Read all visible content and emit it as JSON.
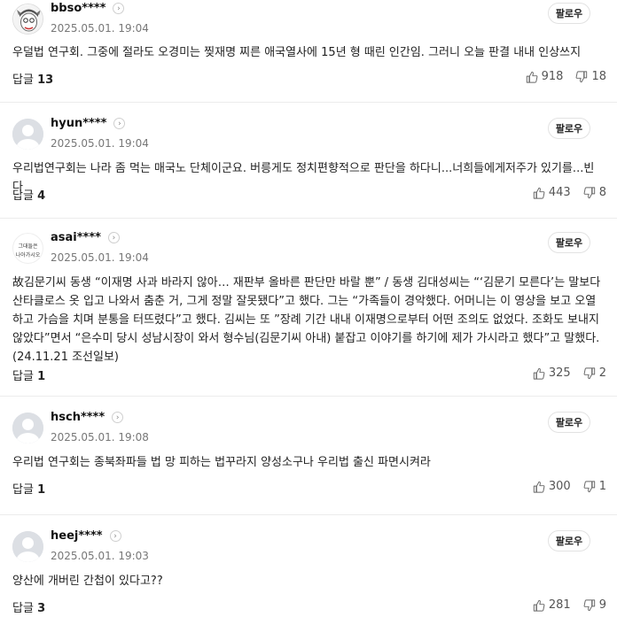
{
  "follow_label": "팔로우",
  "reply_label": "답글",
  "comments": [
    {
      "username": "bbso****",
      "date": "2025.05.01. 19:04",
      "text": "우덜법 연구회. 그중에 절라도 오경미는 찢재명 찌른 애국열사에 15년 형 때린 인간임. 그러니 오늘 판결 내내 인상쓰지",
      "replies": "13",
      "likes": "918",
      "dislikes": "18",
      "avatar": "cartoon-avatar"
    },
    {
      "username": "hyun****",
      "date": "2025.05.01. 19:04",
      "text": "우리법연구회는 나라 좀 먹는 매국노 단체이군요. 버릉게도 정치편향적으로 판단을 하다니...너희들에게저주가 있기를...빈다",
      "replies": "4",
      "likes": "443",
      "dislikes": "8",
      "avatar": "default-avatar"
    },
    {
      "username": "asai****",
      "date": "2025.05.01. 19:04",
      "text": "故김문기씨 동생 “이재명 사과 바라지 않아… 재판부 올바른 판단만 바랄 뿐” / 동생 김대성씨는 “‘김문기 모른다’는 말보다 산타클로스 옷 입고 나와서 춤춘 거, 그게 정말 잘못됐다”고 했다. 그는 “가족들이 경악했다. 어머니는 이 영상을 보고 오열하고 가슴을 치며 분통을 터뜨렸다”고 했다. 김씨는 또 ”장례 기간 내내 이재명으로부터 어떤 조의도 없었다. 조화도 보내지 않았다”면서 “은수미 당시 성남시장이 와서 형수님(김문기씨 아내) 붙잡고 이야기를 하기에 제가 가시라고 했다”고 말했다. (24.11.21 조선일보)",
      "replies": "1",
      "likes": "325",
      "dislikes": "2",
      "avatar": "text-avatar",
      "avatar_text": [
        "그대들은",
        "나아가시오"
      ]
    },
    {
      "username": "hsch****",
      "date": "2025.05.01. 19:08",
      "text": "우리법 연구회는 종북좌파들 법 망 피하는 법꾸라지 양성소구나 우리법 출신 파면시켜라",
      "replies": "1",
      "likes": "300",
      "dislikes": "1",
      "avatar": "default-avatar"
    },
    {
      "username": "heej****",
      "date": "2025.05.01. 19:03",
      "text": "양산에 개버린 간첩이 있다고??",
      "replies": "3",
      "likes": "281",
      "dislikes": "9",
      "avatar": "default-avatar"
    }
  ]
}
